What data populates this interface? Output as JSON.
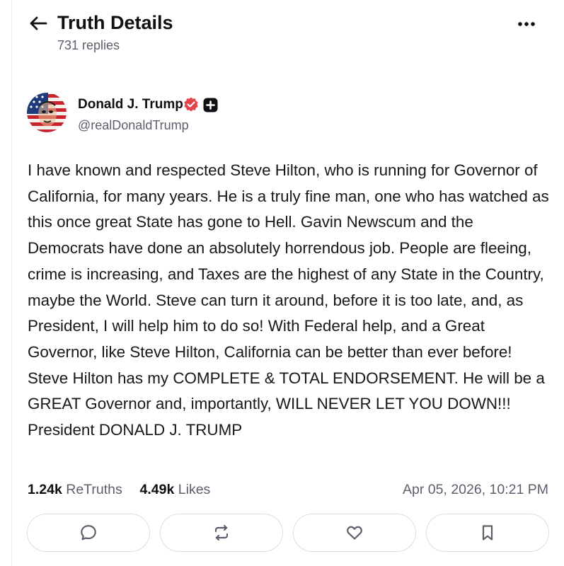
{
  "header": {
    "title": "Truth Details",
    "reply_count": "731 replies"
  },
  "author": {
    "name": "Donald J. Trump",
    "handle": "@realDonaldTrump",
    "verified": true,
    "plus_member": true
  },
  "post": {
    "text": "I have known and respected Steve Hilton, who is running for Governor of California, for many years. He is a truly fine man, one who has watched as this once great State has gone to Hell. Gavin Newscum and the Democrats have done an absolutely horrendous job. People are fleeing, crime is increasing, and Taxes are the highest of any State in the Country, maybe the World. Steve can turn it around, before it is too late, and, as President, I will help him to do so! With Federal help, and a Great Governor, like Steve Hilton, California can be better than ever before! Steve Hilton has my COMPLETE & TOTAL ENDORSEMENT. He will be a GREAT Governor and, importantly, WILL NEVER LET YOU DOWN!!! President DONALD J. TRUMP",
    "retruths_count": "1.24k",
    "retruths_label": "ReTruths",
    "likes_count": "4.49k",
    "likes_label": "Likes",
    "timestamp": "Apr 05, 2026, 10:21 PM"
  },
  "actions": [
    {
      "name": "reply",
      "icon": "chat-bubble-icon"
    },
    {
      "name": "retruth",
      "icon": "repost-icon"
    },
    {
      "name": "like",
      "icon": "heart-icon"
    },
    {
      "name": "bookmark",
      "icon": "bookmark-icon"
    }
  ],
  "colors": {
    "text_primary": "#0f0f14",
    "text_secondary": "#5c5f6b",
    "verified_badge": "#e3434b",
    "border": "#dcdde3",
    "icon": "#5c5f6b"
  }
}
